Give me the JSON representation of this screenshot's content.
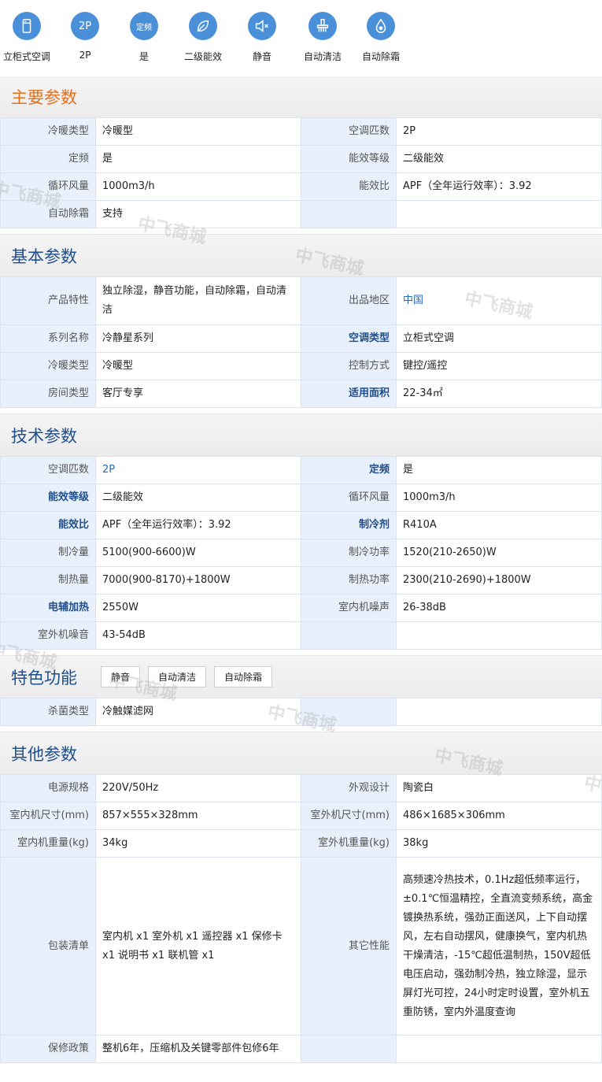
{
  "icons": [
    {
      "name": "fridge-icon",
      "label": "立柜式空调",
      "text": ""
    },
    {
      "name": "2p-icon",
      "label": "2P",
      "text": "2P"
    },
    {
      "name": "fixed-freq-icon",
      "label": "是",
      "text": "定频"
    },
    {
      "name": "leaf-icon",
      "label": "二级能效",
      "text": ""
    },
    {
      "name": "mute-icon",
      "label": "静音",
      "text": ""
    },
    {
      "name": "cleaning-icon",
      "label": "自动清洁",
      "text": ""
    },
    {
      "name": "defrost-icon",
      "label": "自动除霜",
      "text": ""
    }
  ],
  "main": {
    "title": "主要参数",
    "rows": [
      [
        "冷暖类型",
        "冷暖型",
        "空调匹数",
        "2P"
      ],
      [
        "定频",
        "是",
        "能效等级",
        "二级能效"
      ],
      [
        "循环风量",
        "1000m3/h",
        "能效比",
        "APF（全年运行效率）：3.92"
      ],
      [
        "自动除霜",
        "支持",
        "",
        ""
      ]
    ]
  },
  "basic": {
    "title": "基本参数",
    "rows": [
      [
        "产品特性",
        "独立除湿，静音功能，自动除霜，自动清洁",
        "出品地区",
        "中国"
      ],
      [
        "系列名称",
        "冷静星系列",
        "空调类型",
        "立柜式空调"
      ],
      [
        "冷暖类型",
        "冷暖型",
        "控制方式",
        "键控/遥控"
      ],
      [
        "房间类型",
        "客厅专享",
        "适用面积",
        "22-34㎡"
      ]
    ]
  },
  "tech": {
    "title": "技术参数",
    "rows": [
      [
        "空调匹数",
        "2P",
        "定频",
        "是"
      ],
      [
        "能效等级",
        "二级能效",
        "循环风量",
        "1000m3/h"
      ],
      [
        "能效比",
        "APF（全年运行效率）：3.92",
        "制冷剂",
        "R410A"
      ],
      [
        "制冷量",
        "5100(900-6600)W",
        "制冷功率",
        "1520(210-2650)W"
      ],
      [
        "制热量",
        "7000(900-8170)+1800W",
        "制热功率",
        "2300(210-2690)+1800W"
      ],
      [
        "电辅加热",
        "2550W",
        "室内机噪声",
        "26-38dB"
      ],
      [
        "室外机噪音",
        "43-54dB",
        "",
        ""
      ]
    ]
  },
  "feature": {
    "title": "特色功能",
    "tags": [
      "静音",
      "自动清洁",
      "自动除霜"
    ],
    "rows": [
      [
        "杀菌类型",
        "冷触媒滤网",
        "",
        ""
      ]
    ]
  },
  "other": {
    "title": "其他参数",
    "rows": [
      [
        "电源规格",
        "220V/50Hz",
        "外观设计",
        "陶瓷白"
      ],
      [
        "室内机尺寸(mm)",
        "857×555×328mm",
        "室外机尺寸(mm)",
        "486×1685×306mm"
      ],
      [
        "室内机重量(kg)",
        "34kg",
        "室外机重量(kg)",
        "38kg"
      ],
      [
        "包装清单",
        "室内机 x1 室外机 x1 遥控器 x1 保修卡 x1 说明书 x1 联机管 x1",
        "其它性能",
        "高频速冷热技术，0.1Hz超低频率运行，±0.1℃恒温精控，全直流变频系统，高金镀换热系统，强劲正面送风，上下自动摆风，左右自动摆风，健康换气，室内机热干燥清洁，-15℃超低温制热，150V超低电压启动，强劲制冷热，独立除湿，显示屏灯光可控，24小时定时设置，室外机五重防锈，室内外温度查询"
      ],
      [
        "保修政策",
        "整机6年，压缩机及关键零部件包修6年",
        "",
        ""
      ]
    ]
  },
  "watermark": "中飞商城"
}
